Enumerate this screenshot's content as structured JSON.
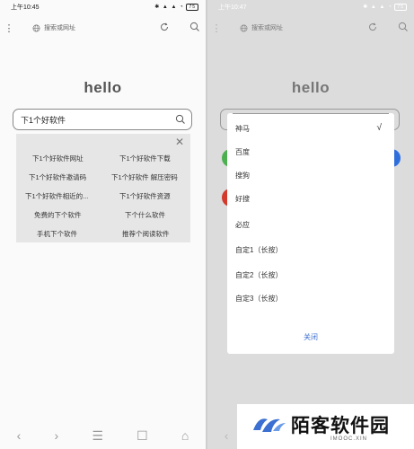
{
  "left": {
    "status": {
      "time": "上午10:45",
      "battery": "75"
    },
    "address_placeholder": "搜索或网址",
    "logo": "hello",
    "search_value": "下1个好软件",
    "suggestions": [
      "下1个好软件网址",
      "下1个好软件下载",
      "下1个好软件邀请码",
      "下1个好软件 解压密码",
      "下1个好软件相近的...",
      "下1个好软件资源",
      "免费的下个软件",
      "下个什么软件",
      "手机下个软件",
      "推荐个阅读软件"
    ],
    "close_symbol": "✕",
    "bottom_nav": [
      "‹",
      "›",
      "☰",
      "☐",
      "⌂"
    ]
  },
  "right": {
    "status": {
      "time": "上午10:47",
      "battery": "75"
    },
    "address_placeholder": "搜索或网址",
    "logo": "hello",
    "engine_options": [
      "神马",
      "百度",
      "搜狗",
      "好搜",
      "必应",
      "自定1（长按）",
      "自定2（长按）",
      "自定3（长按）"
    ],
    "selected_mark": "√",
    "close_label": "关闭",
    "bottom_nav": [
      "‹",
      "›",
      "☰",
      "☐",
      "⌂"
    ]
  },
  "watermark": {
    "title": "陌客软件园",
    "subtitle": "IMOOC.XIN"
  },
  "colors": {
    "accent": "#3b6fd1",
    "green": "#4caf50",
    "blue": "#2f6fdc",
    "red": "#d33a2c"
  }
}
